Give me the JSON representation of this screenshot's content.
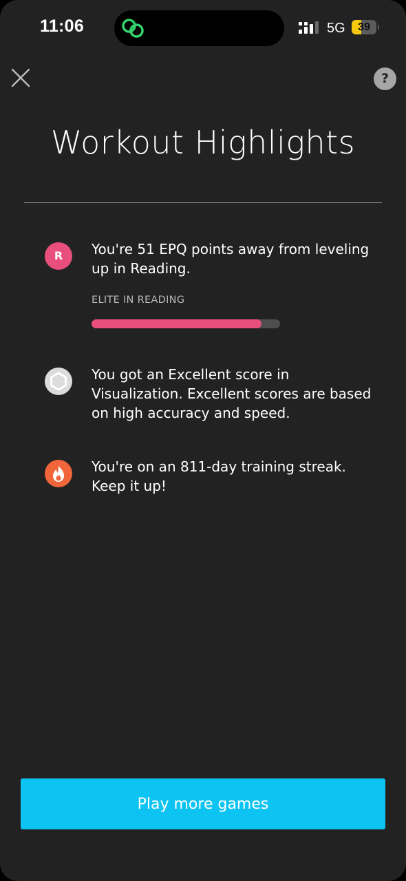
{
  "status_bar": {
    "time": "11:06",
    "network": "5G",
    "battery_level": "39",
    "battery_fraction": 0.39,
    "island_app_icon": "chain-link-icon",
    "signal_icon": "cellular-signal-icon"
  },
  "header": {
    "close_icon": "close-icon",
    "help_label": "?",
    "title": "Workout Highlights"
  },
  "highlights": [
    {
      "icon": "reading-badge-icon",
      "icon_letter": "R",
      "text": "You're 51 EPQ points away from leveling up in Reading.",
      "level_label": "ELITE IN READING",
      "progress": 0.9
    },
    {
      "icon": "hexagon-icon",
      "text": "You got an Excellent score in Visualization. Excellent scores are based on high accuracy and speed."
    },
    {
      "icon": "flame-icon",
      "text": "You're on an 811-day training streak. Keep it up!"
    }
  ],
  "cta": {
    "label": "Play more games"
  },
  "colors": {
    "background": "#222222",
    "reading_pink": "#e84f7d",
    "cta_blue": "#0dc3f2",
    "streak_orange": "#f0653a",
    "battery_yellow": "#f6c90e"
  }
}
